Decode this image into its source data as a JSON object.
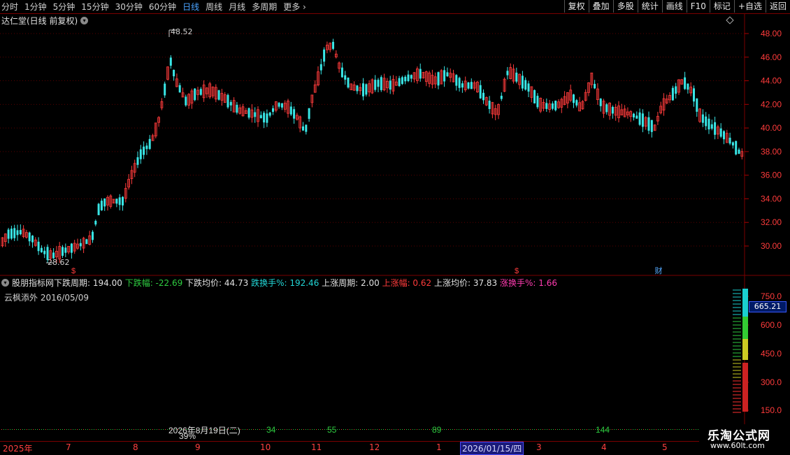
{
  "toolbar": {
    "periods": [
      "分时",
      "1分钟",
      "5分钟",
      "15分钟",
      "30分钟",
      "60分钟",
      "日线",
      "周线",
      "月线",
      "多周期",
      "更多"
    ],
    "active_period": "日线",
    "tools": [
      "复权",
      "叠加",
      "多股",
      "统计",
      "画线",
      "F10",
      "标记",
      "+自选",
      "返回"
    ]
  },
  "stock": {
    "title": "达仁堂(日线 前复权)"
  },
  "main_chart": {
    "high_label": "48.52",
    "low_label": "28.62",
    "y_ticks": [
      "48.00",
      "46.00",
      "44.00",
      "42.00",
      "40.00",
      "38.00",
      "36.00",
      "34.00",
      "32.00",
      "30.00"
    ],
    "markers": [
      "$",
      "$",
      "财"
    ]
  },
  "indicator": {
    "name": "股朋指标网",
    "fields": [
      {
        "label": "下跌周期:",
        "value": "194.00",
        "color": "w"
      },
      {
        "label": "下跌幅:",
        "value": "-22.69",
        "color": "g"
      },
      {
        "label": "下跌均价:",
        "value": "44.73",
        "color": "w"
      },
      {
        "label": "跌换手%:",
        "value": "192.46",
        "color": "c"
      },
      {
        "label": "上涨周期:",
        "value": "2.00",
        "color": "w"
      },
      {
        "label": "上涨幅:",
        "value": "0.62",
        "color": "r"
      },
      {
        "label": "上涨均价:",
        "value": "37.83",
        "color": "w"
      },
      {
        "label": "涨换手%:",
        "value": "1.66",
        "color": "m"
      }
    ],
    "info_line": "云枫添外 2016/05/09",
    "y_ticks": [
      "750.0",
      "600.0",
      "450.0",
      "300.0",
      "150.0"
    ],
    "current_value": "665.21",
    "bottom_labels": [
      "2026年8月19日(二)",
      "34",
      "55",
      "89",
      "144",
      "39%"
    ]
  },
  "date_axis": {
    "labels": [
      "2025年",
      "7",
      "8",
      "9",
      "10",
      "11",
      "12",
      "1",
      "2026/01/15/四",
      "3",
      "4",
      "5"
    ]
  },
  "watermark": {
    "title": "乐淘公式网",
    "url": "www.60lt.com"
  }
}
